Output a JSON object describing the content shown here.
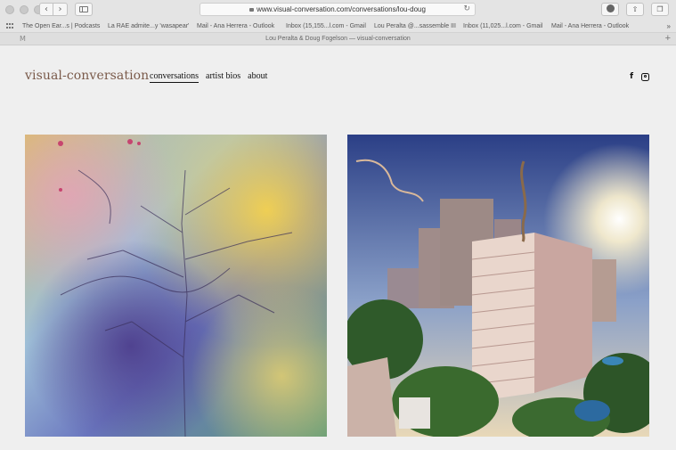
{
  "browser": {
    "url": "www.visual-conversation.com/conversations/lou-doug",
    "tab_title": "Lou Peralta & Doug Fogelson — visual-conversation",
    "tab_pinned_label": "M",
    "bookmarks": [
      "The Open Ear...s | Podcasts",
      "La RAE admite...y 'wasapear'",
      "Mail - Ana Herrera - Outlook",
      "Inbox (15,155...l.com - Gmail",
      "Lou Peralta @...sassemble III",
      "Inbox (11,025...l.com - Gmail",
      "Mail - Ana Herrera - Outlook"
    ],
    "back_glyph": "‹",
    "forward_glyph": "›",
    "reload_glyph": "↻",
    "more_glyph": "»",
    "plus_glyph": "+"
  },
  "site": {
    "logo": "visual-conversation",
    "nav": [
      "conversations",
      "artist bios",
      "about"
    ],
    "social": {
      "facebook_glyph": "f",
      "icons": [
        "facebook-icon",
        "instagram-icon"
      ]
    }
  },
  "artworks": [
    {
      "name": "abstract-tree-artwork",
      "palette": [
        "#f0c84a",
        "#6fa8d8",
        "#7c4fa8",
        "#5c9a7a",
        "#d98ab0"
      ]
    },
    {
      "name": "city-building-photo",
      "palette": [
        "#2f4a8a",
        "#f6e6c6",
        "#c9b2a8",
        "#2e5a2e"
      ]
    }
  ]
}
